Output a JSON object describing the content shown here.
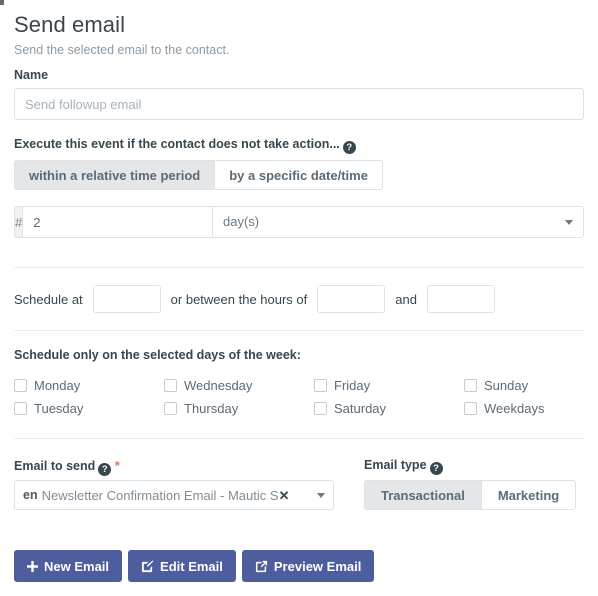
{
  "header": {
    "title": "Send email",
    "subtitle": "Send the selected email to the contact."
  },
  "name_field": {
    "label": "Name",
    "value": "Send followup email",
    "placeholder": "Send followup email"
  },
  "execute": {
    "label": "Execute this event if the contact does not take action...",
    "help_icon": "question-circle-icon",
    "options": [
      {
        "label": "within a relative time period",
        "active": true
      },
      {
        "label": "by a specific date/time",
        "active": false
      }
    ]
  },
  "interval": {
    "addon": "#",
    "value": "2",
    "unit": "day(s)",
    "caret_icon": "caret-down-icon"
  },
  "schedule": {
    "prefix": "Schedule at",
    "at_value": "",
    "middle": "or between the hours of",
    "from_value": "",
    "conjunction": "and",
    "to_value": ""
  },
  "days": {
    "label": "Schedule only on the selected days of the week:",
    "items": [
      {
        "label": "Monday",
        "checked": false
      },
      {
        "label": "Wednesday",
        "checked": false
      },
      {
        "label": "Friday",
        "checked": false
      },
      {
        "label": "Sunday",
        "checked": false
      },
      {
        "label": "Tuesday",
        "checked": false
      },
      {
        "label": "Thursday",
        "checked": false
      },
      {
        "label": "Saturday",
        "checked": false
      },
      {
        "label": "Weekdays",
        "checked": false
      }
    ]
  },
  "email_to_send": {
    "label": "Email to send",
    "help_icon": "question-circle-icon",
    "required_marker": "*",
    "chip_language": "en",
    "chip_text": "Newsletter Confirmation Email - Mautic S..",
    "clear_icon": "close-icon",
    "caret_icon": "caret-down-icon"
  },
  "email_type": {
    "label": "Email type",
    "help_icon": "question-circle-icon",
    "options": [
      {
        "label": "Transactional",
        "active": true
      },
      {
        "label": "Marketing",
        "active": false
      }
    ]
  },
  "footer": {
    "buttons": [
      {
        "label": "New Email",
        "icon": "plus-icon"
      },
      {
        "label": "Edit Email",
        "icon": "pencil-square-icon"
      },
      {
        "label": "Preview Email",
        "icon": "external-link-icon"
      }
    ]
  },
  "colors": {
    "primary_button": "#4e5d9e",
    "text": "#37474f",
    "muted_text": "#8d9aa5",
    "border": "#dfe3e6",
    "active_toggle_bg": "#e4e6e8",
    "required_red": "#f2705a"
  }
}
